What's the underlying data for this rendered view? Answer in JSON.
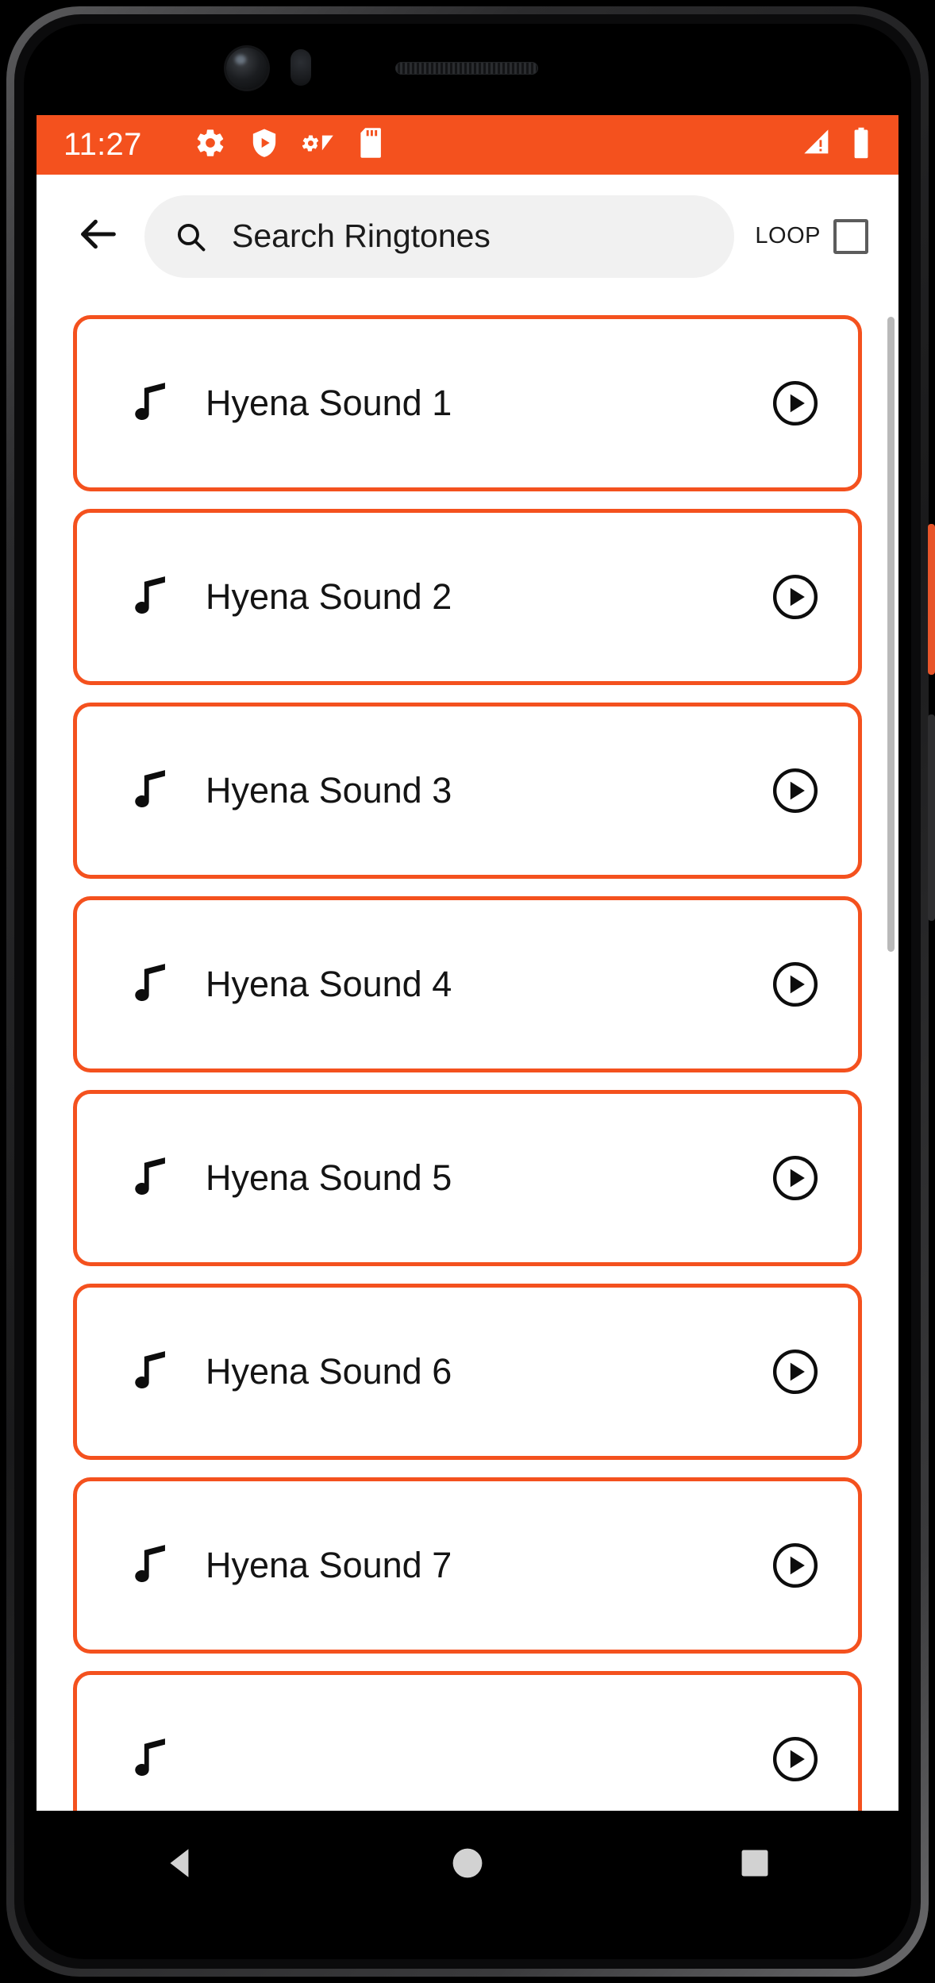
{
  "status_bar": {
    "time": "11:27",
    "left_icons": [
      "gear-icon",
      "shield-play-icon",
      "wifi-settings-icon",
      "sd-card-icon"
    ],
    "right_icons": [
      "cellular-signal-icon",
      "battery-icon"
    ],
    "background_color": "#F4511E"
  },
  "app_bar": {
    "back_icon": "back-arrow-icon",
    "search": {
      "icon": "search-icon",
      "placeholder": "Search Ringtones",
      "value": ""
    },
    "loop": {
      "label": "LOOP",
      "checked": false
    }
  },
  "list": {
    "items": [
      {
        "title": "Hyena Sound 1",
        "leading_icon": "music-note-icon",
        "action_icon": "play-circle-icon"
      },
      {
        "title": "Hyena Sound 2",
        "leading_icon": "music-note-icon",
        "action_icon": "play-circle-icon"
      },
      {
        "title": "Hyena Sound 3",
        "leading_icon": "music-note-icon",
        "action_icon": "play-circle-icon"
      },
      {
        "title": "Hyena Sound 4",
        "leading_icon": "music-note-icon",
        "action_icon": "play-circle-icon"
      },
      {
        "title": "Hyena Sound 5",
        "leading_icon": "music-note-icon",
        "action_icon": "play-circle-icon"
      },
      {
        "title": "Hyena Sound 6",
        "leading_icon": "music-note-icon",
        "action_icon": "play-circle-icon"
      },
      {
        "title": "Hyena Sound 7",
        "leading_icon": "music-note-icon",
        "action_icon": "play-circle-icon"
      },
      {
        "title": "",
        "leading_icon": "music-note-icon",
        "action_icon": "play-circle-icon"
      }
    ],
    "accent_color": "#F4511E"
  },
  "nav_bar": {
    "items": [
      "back-triangle-icon",
      "home-circle-icon",
      "recents-square-icon"
    ]
  }
}
